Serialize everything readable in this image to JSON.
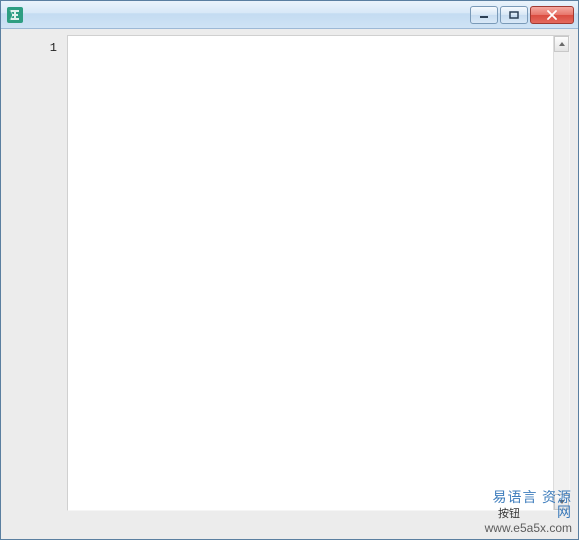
{
  "window": {
    "title": ""
  },
  "editor": {
    "line_number": "1",
    "content": ""
  },
  "button": {
    "label": "按钮"
  },
  "watermark": {
    "cn": "易语言 资源 网",
    "url": "www.e5a5x.com"
  },
  "icons": {
    "app": "易",
    "minimize": "minimize-icon",
    "maximize": "maximize-icon",
    "close": "close-icon",
    "scroll_up": "chevron-up-icon",
    "scroll_down": "chevron-down-icon"
  }
}
